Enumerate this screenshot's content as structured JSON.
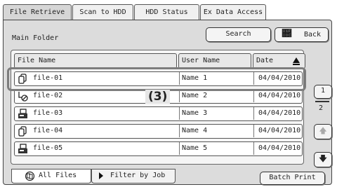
{
  "tabs": [
    {
      "label": "File Retrieve",
      "active": true
    },
    {
      "label": "Scan to HDD",
      "active": false
    },
    {
      "label": "HDD Status",
      "active": false
    },
    {
      "label": "Ex Data Access",
      "active": false
    }
  ],
  "folder": {
    "label": "Main Folder"
  },
  "toolbar": {
    "search_label": "Search",
    "back_label": "Back"
  },
  "columns": {
    "file_name": "File Name",
    "user_name": "User Name",
    "date": "Date"
  },
  "files": [
    {
      "name": "file-01",
      "user": "Name 1",
      "date": "04/04/2010",
      "icon": "print-job-icon"
    },
    {
      "name": "file-02",
      "user": "Name 2",
      "date": "04/04/2010",
      "icon": "scan-job-icon"
    },
    {
      "name": "file-03",
      "user": "Name 3",
      "date": "04/04/2010",
      "icon": "copy-job-icon"
    },
    {
      "name": "file-04",
      "user": "Name 4",
      "date": "04/04/2010",
      "icon": "print-job-icon"
    },
    {
      "name": "file-05",
      "user": "Name 5",
      "date": "04/04/2010",
      "icon": "copy-job-icon"
    }
  ],
  "callout": "(3)",
  "pager": {
    "current": "1",
    "total": "2"
  },
  "bottom_tabs": {
    "all_files": "All Files",
    "filter_by_job": "Filter by Job"
  },
  "batch_print_label": "Batch Print",
  "colors": {
    "panel_bg": "#dcdcdc",
    "highlight": "#7d7d7d"
  }
}
